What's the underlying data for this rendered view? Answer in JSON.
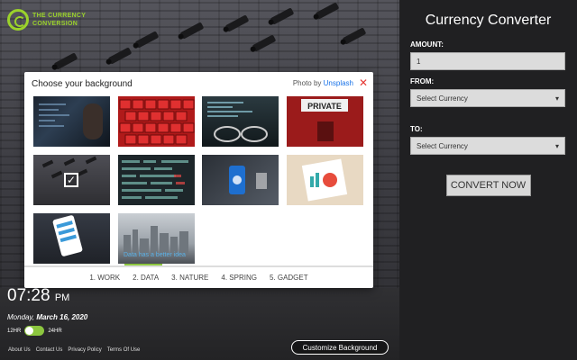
{
  "logo": {
    "line1": "THE CURRENCY",
    "line2": "CONVERSION",
    "icon": "currency-logo-icon"
  },
  "converter": {
    "title": "Currency Converter",
    "amount_label": "AMOUNT:",
    "amount_value": "1",
    "from_label": "FROM:",
    "from_value": "Select Currency",
    "to_label": "TO:",
    "to_value": "Select Currency",
    "convert_label": "CONVERT NOW"
  },
  "modal": {
    "title": "Choose your background",
    "credit_prefix": "Photo by",
    "credit_link": "Unsplash",
    "close_icon": "close-icon",
    "thumbnails": [
      {
        "name": "hacker-code",
        "selected": false
      },
      {
        "name": "red-keyboard",
        "selected": false
      },
      {
        "name": "glasses-monitor",
        "selected": false
      },
      {
        "name": "private-sign",
        "selected": false
      },
      {
        "name": "security-cameras",
        "selected": true
      },
      {
        "name": "matrix-data",
        "selected": false
      },
      {
        "name": "hand-phone",
        "selected": false
      },
      {
        "name": "chart-papers",
        "selected": false
      },
      {
        "name": "phone-app",
        "selected": false
      },
      {
        "name": "city-skyline",
        "selected": false,
        "caption": "Data has a better idea"
      }
    ],
    "categories": [
      "1. WORK",
      "2. DATA",
      "3. NATURE",
      "4. SPRING",
      "5. GADGET"
    ],
    "active_category": "2. DATA"
  },
  "clock": {
    "time": "07:28",
    "ampm": "PM",
    "date_day": "Monday,",
    "date_rest": "March 16, 2020",
    "fmt12": "12HR",
    "fmt24": "24HR"
  },
  "footer": {
    "links": [
      "About Us",
      "Contact Us",
      "Privacy Policy",
      "Terms Of Use"
    ],
    "customize_label": "Customize Background"
  },
  "colors": {
    "accent": "#8cc63f",
    "panel": "#202022",
    "close": "#e53935",
    "link": "#1a73e8"
  }
}
